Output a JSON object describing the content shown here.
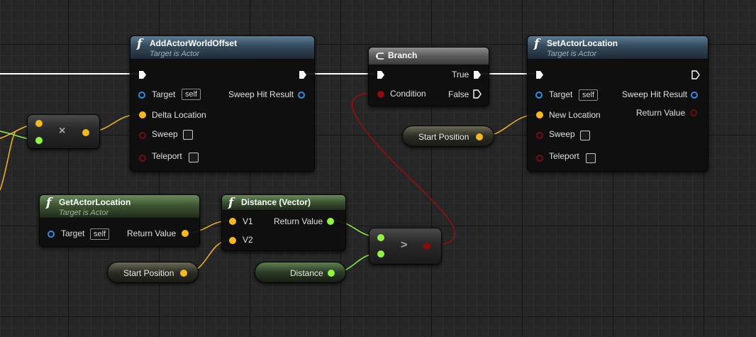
{
  "nodes": {
    "add_actor_world_offset": {
      "title": "AddActorWorldOffset",
      "subtitle": "Target is Actor",
      "pins": {
        "target": "Target",
        "self": "self",
        "delta_location": "Delta Location",
        "sweep": "Sweep",
        "teleport": "Teleport",
        "sweep_hit_result": "Sweep Hit Result"
      }
    },
    "branch": {
      "title": "Branch",
      "pins": {
        "condition": "Condition",
        "true": "True",
        "false": "False"
      }
    },
    "set_actor_location": {
      "title": "SetActorLocation",
      "subtitle": "Target is Actor",
      "pins": {
        "target": "Target",
        "self": "self",
        "new_location": "New Location",
        "sweep": "Sweep",
        "teleport": "Teleport",
        "sweep_hit_result": "Sweep Hit Result",
        "return_value": "Return Value"
      }
    },
    "get_actor_location": {
      "title": "GetActorLocation",
      "subtitle": "Target is Actor",
      "pins": {
        "target": "Target",
        "self": "self",
        "return_value": "Return Value"
      }
    },
    "distance_vector": {
      "title": "Distance (Vector)",
      "pins": {
        "v1": "V1",
        "v2": "V2",
        "return_value": "Return Value"
      }
    },
    "multiply": {
      "symbol": "×"
    },
    "greater": {
      "symbol": ">"
    },
    "var_start_position_1": {
      "label": "Start Position"
    },
    "var_start_position_2": {
      "label": "Start Position"
    },
    "var_distance": {
      "label": "Distance"
    }
  },
  "colors": {
    "vector_pin": "#f5b821",
    "float_pin": "#92f545",
    "object_pin": "#2e8ee6",
    "bool_pin": "#8e0b0b",
    "exec_wire": "#ffffff"
  }
}
